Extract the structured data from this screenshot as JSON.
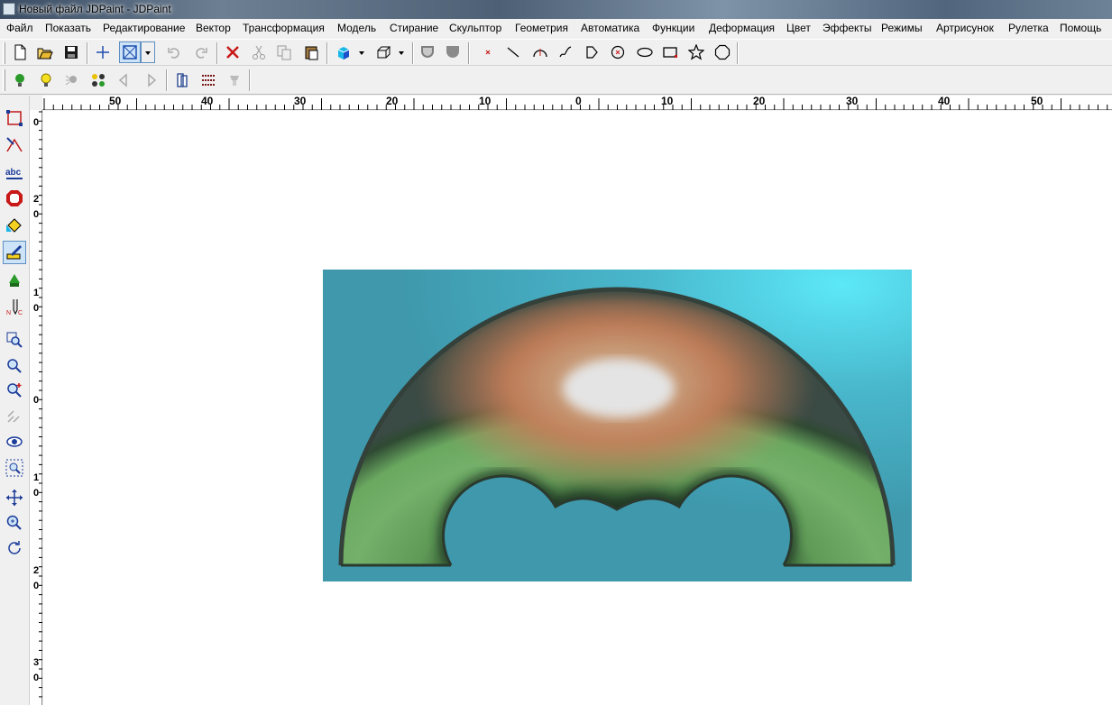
{
  "window": {
    "title": "Новый файл JDPaint - JDPaint"
  },
  "menu": [
    "Файл",
    "Показать",
    "Редактирование",
    "Вектор",
    "Трансформация",
    "Модель",
    "Стирание",
    "Скульптор",
    "Геометрия",
    "Автоматика",
    "Функции",
    "Деформация",
    "Цвет",
    "Эффекты",
    "Режимы",
    "Артрисунок",
    "Рулетка",
    "Помощь"
  ],
  "hruler_labels": [
    "50",
    "40",
    "30",
    "20",
    "10",
    "0",
    "10",
    "20",
    "30",
    "40",
    "50"
  ],
  "vruler_labels": [
    [
      "0"
    ],
    [
      "2",
      "0"
    ],
    [
      "1",
      "0"
    ],
    [
      "0"
    ],
    [
      "1",
      "0"
    ],
    [
      "2",
      "0"
    ],
    [
      "3",
      "0"
    ]
  ],
  "colors": {
    "background": "#4aa4b6",
    "arch_green": "#6aa860",
    "arch_top": "#c87e58"
  }
}
